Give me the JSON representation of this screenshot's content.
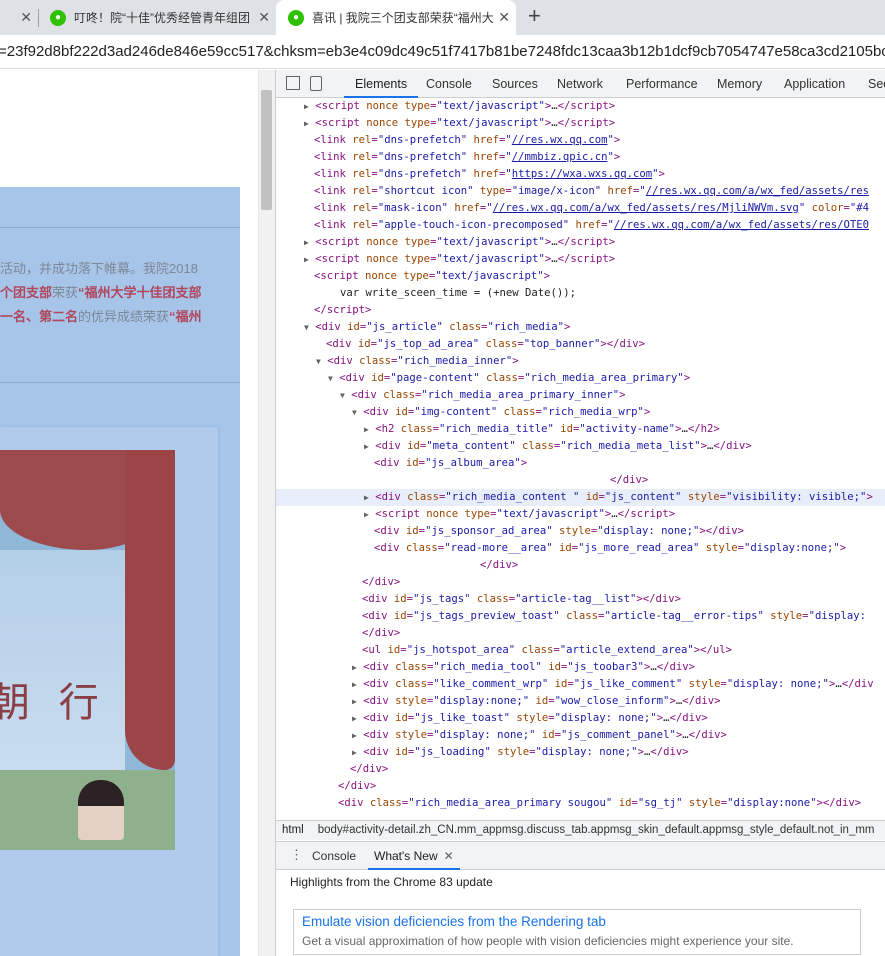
{
  "browser": {
    "tabs": [
      {
        "title": ""
      },
      {
        "title": "叮咚！院“十佳”优秀经管青年组团",
        "close": "✕"
      },
      {
        "title": "喜讯 | 我院三个团支部荣获“福州大",
        "close": "✕"
      }
    ],
    "new_tab": "+",
    "url": "=23f92d8bf222d3ad246de846e59cc517&chksm=eb3e4c09dc49c51f7417b81be7248fdc13caa3b12b1dcf9cb7054747e58ca3cd2105bc"
  },
  "article": {
    "line1": "活动，并成功落下帷幕。我院2018",
    "line2_red1": "个团支部",
    "line2_mid": "荣获",
    "line2_red2": "“福州大学十佳团支部",
    "line3_red1": "一名、第二名",
    "line3_mid": "的优异成绩荣获",
    "line3_red2": "“福州",
    "photo_caption": "朝 行"
  },
  "devtools": {
    "tabs": [
      "Elements",
      "Console",
      "Sources",
      "Network",
      "Performance",
      "Memory",
      "Application",
      "Sec"
    ],
    "active_tab": "Elements",
    "breadcrumbs": [
      "html",
      "body#activity-detail.zh_CN.mm_appmsg.discuss_tab.appmsg_skin_default.appmsg_style_default.not_in_mm"
    ],
    "drawer_tabs": [
      "Console",
      "What's New"
    ],
    "drawer_close": "✕",
    "highlights_title": "Highlights from the Chrome 83 update",
    "feature_title": "Emulate vision deficiencies from the Rendering tab",
    "feature_desc": "Get a visual approximation of how people with vision deficiencies might experience your site."
  }
}
